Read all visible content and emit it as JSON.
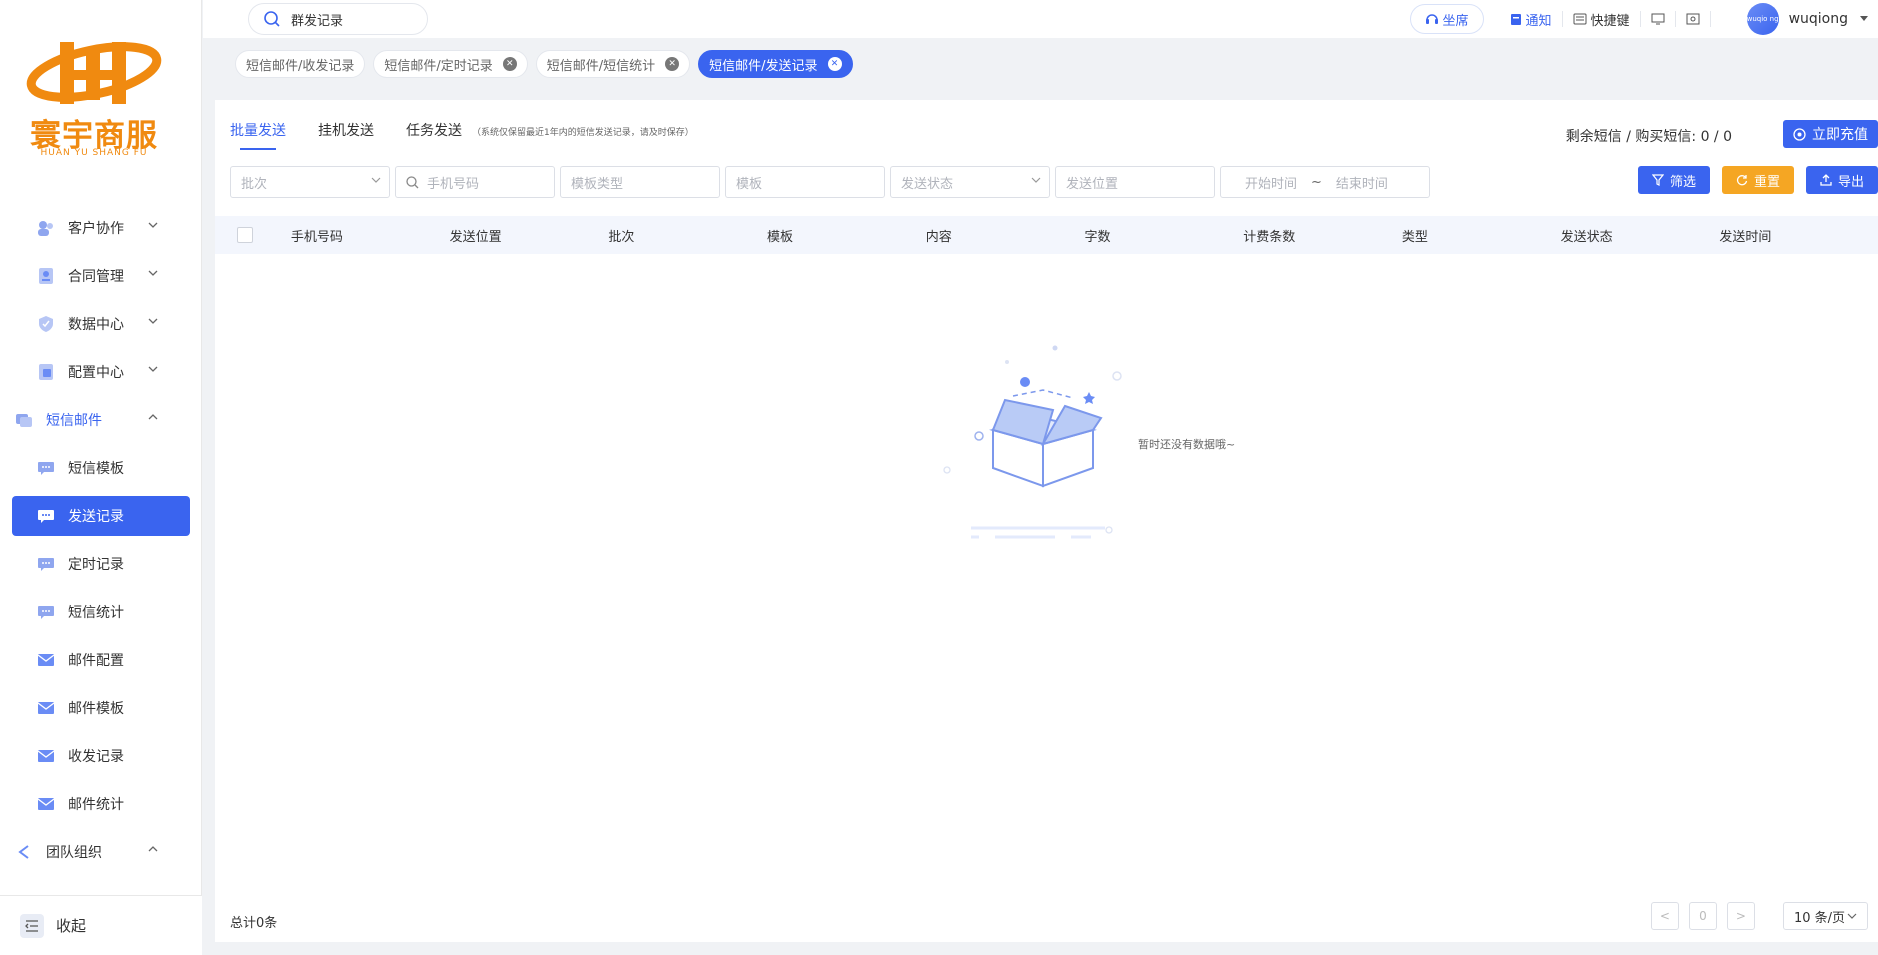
{
  "logo": {
    "text": "寰宇商服",
    "subtext": "HUAN YU SHANG FU"
  },
  "header": {
    "search_value": "群发记录",
    "seat_label": "坐席",
    "notify_label": "通知",
    "shortcut_label": "快捷键",
    "avatar_text": "wuqio ng",
    "username": "wuqiong"
  },
  "sidebar": {
    "items": [
      {
        "label": "客户协作",
        "icon": "users-icon"
      },
      {
        "label": "合同管理",
        "icon": "contract-icon"
      },
      {
        "label": "数据中心",
        "icon": "shield-icon"
      },
      {
        "label": "配置中心",
        "icon": "config-icon"
      }
    ],
    "group_sms": "短信邮件",
    "sms_items": [
      {
        "label": "短信模板"
      },
      {
        "label": "发送记录"
      },
      {
        "label": "定时记录"
      },
      {
        "label": "短信统计"
      },
      {
        "label": "邮件配置"
      },
      {
        "label": "邮件模板"
      },
      {
        "label": "收发记录"
      },
      {
        "label": "邮件统计"
      }
    ],
    "group_team": "团队组织",
    "collapse_label": "收起"
  },
  "tabs": [
    {
      "label": "短信邮件/收发记录"
    },
    {
      "label": "短信邮件/定时记录"
    },
    {
      "label": "短信邮件/短信统计"
    },
    {
      "label": "短信邮件/发送记录"
    }
  ],
  "subtabs": {
    "batch": "批量发送",
    "hangup": "挂机发送",
    "task": "任务发送",
    "note": "（系统仅保留最近1年内的短信发送记录，请及时保存）"
  },
  "quota": "剩余短信 / 购买短信: 0 / 0",
  "recharge_label": "立即充值",
  "filters": {
    "batch": "批次",
    "phone": "手机号码",
    "template_type": "模板类型",
    "template": "模板",
    "status": "发送状态",
    "position": "发送位置",
    "start_time": "开始时间",
    "tilde": "~",
    "end_time": "结束时间"
  },
  "buttons": {
    "filter": "筛选",
    "reset": "重置",
    "export": "导出"
  },
  "table": {
    "columns": [
      "手机号码",
      "发送位置",
      "批次",
      "模板",
      "内容",
      "字数",
      "计费条数",
      "类型",
      "发送状态",
      "发送时间"
    ],
    "empty_text": "暂时还没有数据哦~"
  },
  "footer": {
    "total": "总计0条",
    "page": "0",
    "page_size": "10 条/页"
  },
  "colors": {
    "primary": "#3a64ef",
    "orange": "#f5a623",
    "brand": "#f08a10"
  }
}
